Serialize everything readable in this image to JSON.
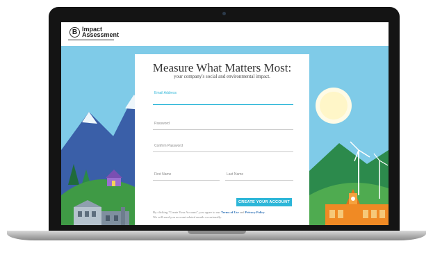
{
  "header": {
    "logo_mark": "B",
    "logo_line1": "Impact",
    "logo_line2": "Assessment"
  },
  "form": {
    "title": "Measure What Matters Most:",
    "subtitle": "your company's social and environmental impact.",
    "fields": {
      "email": {
        "label": "Email Address",
        "value": ""
      },
      "password": {
        "label": "Password",
        "value": ""
      },
      "confirm_password": {
        "label": "Confirm Password",
        "value": ""
      },
      "first_name": {
        "label": "First Name",
        "value": ""
      },
      "last_name": {
        "label": "Last Name",
        "value": ""
      }
    },
    "create_button": "CREATE YOUR ACCOUNT",
    "legal": {
      "prefix": "By clicking \"Create Your Account\", you agree to our ",
      "terms_link": "Terms of Use",
      "and": " and ",
      "privacy_link": "Privacy Policy",
      "suffix": ".",
      "line2": "We will send you account related emails occasionally."
    }
  },
  "colors": {
    "accent": "#2db6d8",
    "sky": "#7fcbe8",
    "link": "#2a6eb5"
  },
  "icons": [
    "b-corp-logo-icon",
    "webcam-icon"
  ]
}
